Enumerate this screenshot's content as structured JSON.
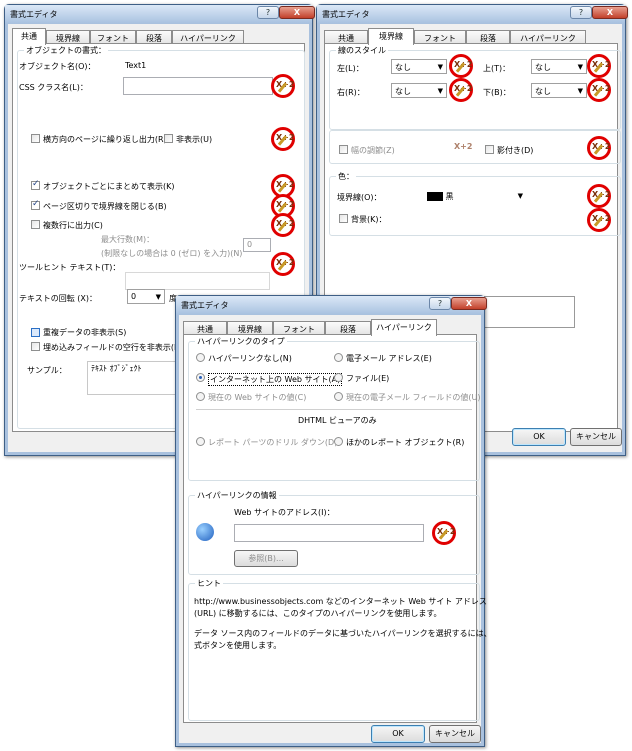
{
  "win1": {
    "title": "書式エディタ",
    "help": "?",
    "close": "X",
    "tabs": [
      "共通",
      "境界線",
      "フォント",
      "段落",
      "ハイパーリンク"
    ],
    "obj_format": "オブジェクトの書式：",
    "obj_name_label": "オブジェクト名(O)：",
    "obj_name_value": "Text1",
    "css_label": "CSS クラス名(L)：",
    "repeat_page": "横方向のページに繰り返し出力(R)",
    "hide": "非表示(U)",
    "keep_together": "オブジェクトごとにまとめて表示(K)",
    "close_border": "ページ区切りで境界線を閉じる(B)",
    "multi_line": "複数行に出力(C)",
    "max_lines": "最大行数(M)：",
    "max_lines_note": "(制限なしの場合は 0 (ゼロ) を入力)(N)",
    "max_lines_value": "0",
    "tooltip_label": "ツールヒント テキスト(T)：",
    "rotation_label": "テキストの回転 (X)：",
    "rotation_value": "0",
    "rotation_unit": "度",
    "suppress_dup": "重複データの非表示(S)",
    "suppress_blank": "埋め込みフィールドの空行を非表示(E)",
    "sample_label": "サンプル：",
    "sample_text": "ﾃｷｽﾄ ｵﾌﾞｼﾞｪｸﾄ"
  },
  "win2": {
    "title": "書式エディタ",
    "help": "?",
    "close": "X",
    "tabs": [
      "共通",
      "境界線",
      "フォント",
      "段落",
      "ハイパーリンク"
    ],
    "line_style": "線のスタイル",
    "left": "左(L)：",
    "top": "上(T)：",
    "right": "右(R)：",
    "bottom": "下(B)：",
    "none": "なし",
    "tight": "幅の調節(Z)",
    "shadow": "影付き(D)",
    "color": "色：",
    "border_color": "境界線(O)：",
    "border_color_value": "黒",
    "background": "背景(K)：",
    "ok": "OK",
    "cancel": "キャンセル"
  },
  "win3": {
    "title": "書式エディタ",
    "help": "?",
    "close": "X",
    "tabs": [
      "共通",
      "境界線",
      "フォント",
      "段落",
      "ハイパーリンク"
    ],
    "type_group": "ハイパーリンクのタイプ",
    "no_link": "ハイパーリンクなし(N)",
    "email": "電子メール アドレス(E)",
    "website": "インターネット上の Web サイト(A)",
    "file": "ファイル(E)",
    "current_web": "現在の Web サイトの値(C)",
    "current_email": "現在の電子メール フィールドの値(U)",
    "dhtml": "DHTML ビューアのみ",
    "drill": "レポート パーツのドリル ダウン(D)",
    "other_report": "ほかのレポート オブジェクト(R)",
    "info_group": "ハイパーリンクの情報",
    "address_label": "Web サイトのアドレス(I)：",
    "browse": "参照(B)...",
    "hint_group": "ヒント",
    "hint1": "http://www.businessobjects.com などのインターネット Web サイト アドレス",
    "hint2": "(URL) に移動するには、このタイプのハイパーリンクを使用します。",
    "hint3": "データ ソース内のフィールドのデータに基づいたハイパーリンクを選択するには、",
    "hint4": "式ボタンを使用します。",
    "ok": "OK",
    "cancel": "キャンセル"
  },
  "formula_icon_text": "X+2"
}
